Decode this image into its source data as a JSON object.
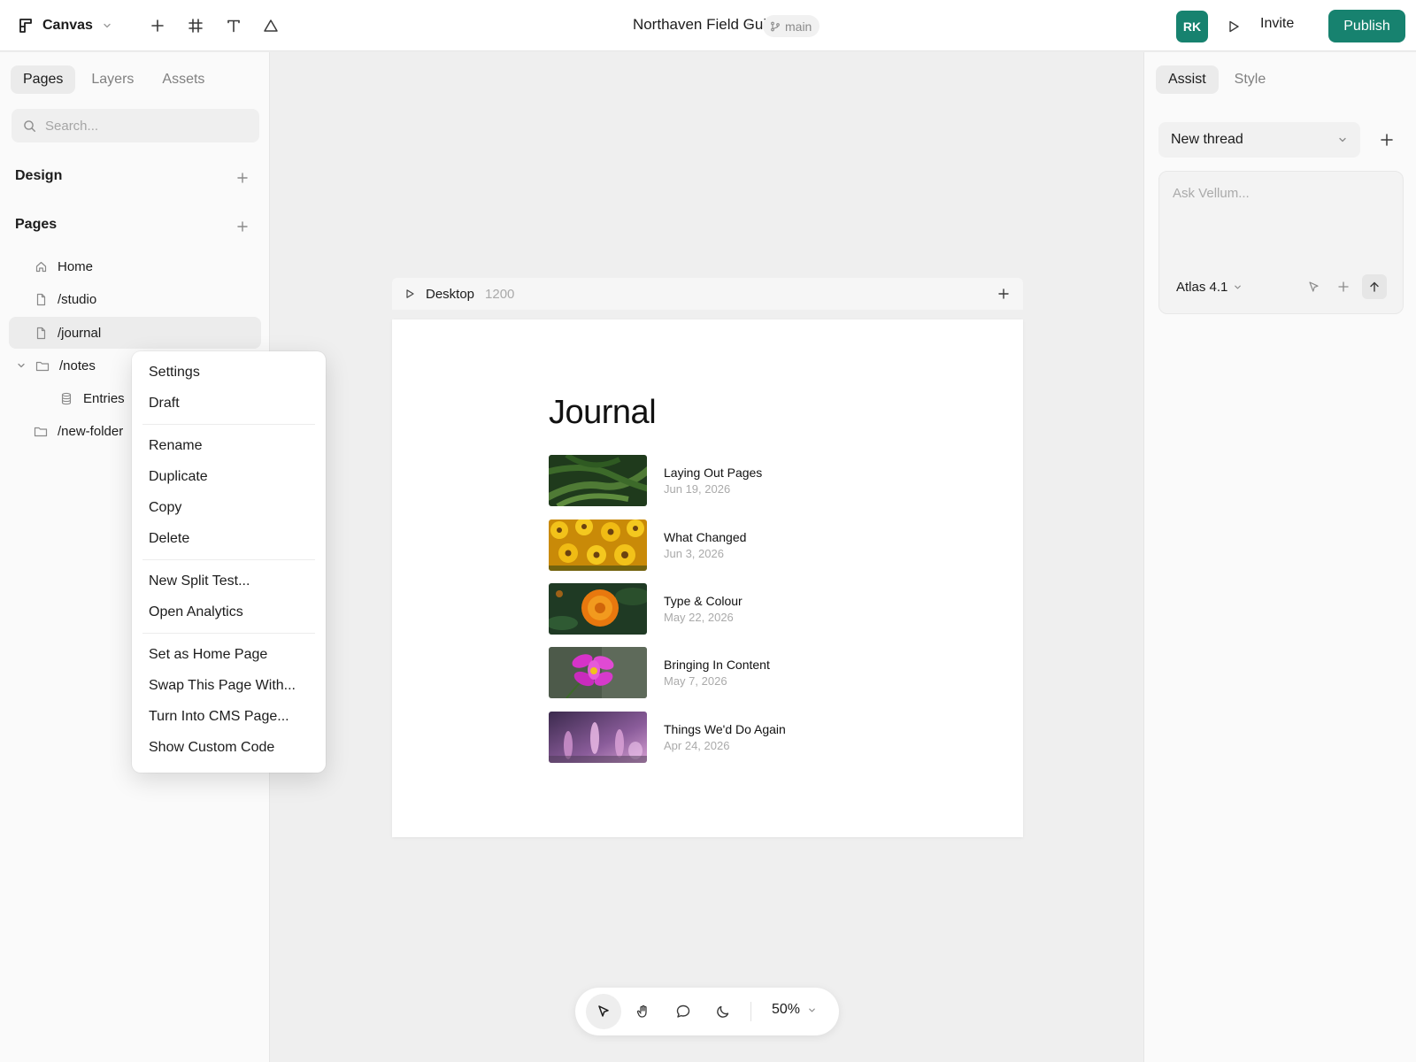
{
  "topbar": {
    "app_name": "Canvas",
    "document_title": "Northaven Field Guide",
    "branch": "main",
    "avatar_initials": "RK",
    "invite_label": "Invite",
    "publish_label": "Publish",
    "tools": [
      "plus-icon",
      "frame-grid-icon",
      "text-icon",
      "shape-triangle-icon"
    ]
  },
  "left_panel": {
    "tabs": [
      {
        "label": "Pages",
        "active": true
      },
      {
        "label": "Layers",
        "active": false
      },
      {
        "label": "Assets",
        "active": false
      }
    ],
    "search_placeholder": "Search...",
    "design_section": "Design",
    "pages_section": "Pages",
    "pages": [
      {
        "label": "Home",
        "icon": "home-icon"
      },
      {
        "label": "/studio",
        "icon": "page-icon"
      },
      {
        "label": "/journal",
        "icon": "page-icon",
        "selected": true
      },
      {
        "label": "/notes",
        "icon": "folder-icon",
        "expanded": true
      },
      {
        "label": "Entries",
        "icon": "database-icon",
        "nested": true
      },
      {
        "label": "/new-folder",
        "icon": "folder-icon"
      }
    ]
  },
  "context_menu": {
    "groups": [
      [
        "Settings",
        "Draft"
      ],
      [
        "Rename",
        "Duplicate",
        "Copy",
        "Delete"
      ],
      [
        "New Split Test...",
        "Open Analytics"
      ],
      [
        "Set as Home Page",
        "Swap This Page With...",
        "Turn Into CMS Page...",
        "Show Custom Code"
      ]
    ]
  },
  "canvas": {
    "frame_name": "Desktop",
    "frame_width": "1200",
    "heading": "Journal",
    "entries": [
      {
        "title": "Laying Out Pages",
        "date": "Jun 19, 2026",
        "thumb": "fern"
      },
      {
        "title": "What Changed",
        "date": "Jun 3, 2026",
        "thumb": "sunflowers"
      },
      {
        "title": "Type & Colour",
        "date": "May 22, 2026",
        "thumb": "marigold"
      },
      {
        "title": "Bringing In Content",
        "date": "May 7, 2026",
        "thumb": "cosmos"
      },
      {
        "title": "Things We'd Do Again",
        "date": "Apr 24, 2026",
        "thumb": "lupine"
      }
    ]
  },
  "right_panel": {
    "tabs": [
      {
        "label": "Assist",
        "active": true
      },
      {
        "label": "Style",
        "active": false
      }
    ],
    "thread_label": "New thread",
    "assist_placeholder": "Ask Vellum...",
    "model": "Atlas 4.1"
  },
  "bottom_toolbar": {
    "tools": [
      "pointer-icon",
      "hand-icon",
      "comment-icon",
      "moon-icon"
    ],
    "zoom": "50%"
  },
  "colors": {
    "accent": "#17826f",
    "canvas_bg": "#efefef",
    "panel_bg": "#fafafa"
  }
}
